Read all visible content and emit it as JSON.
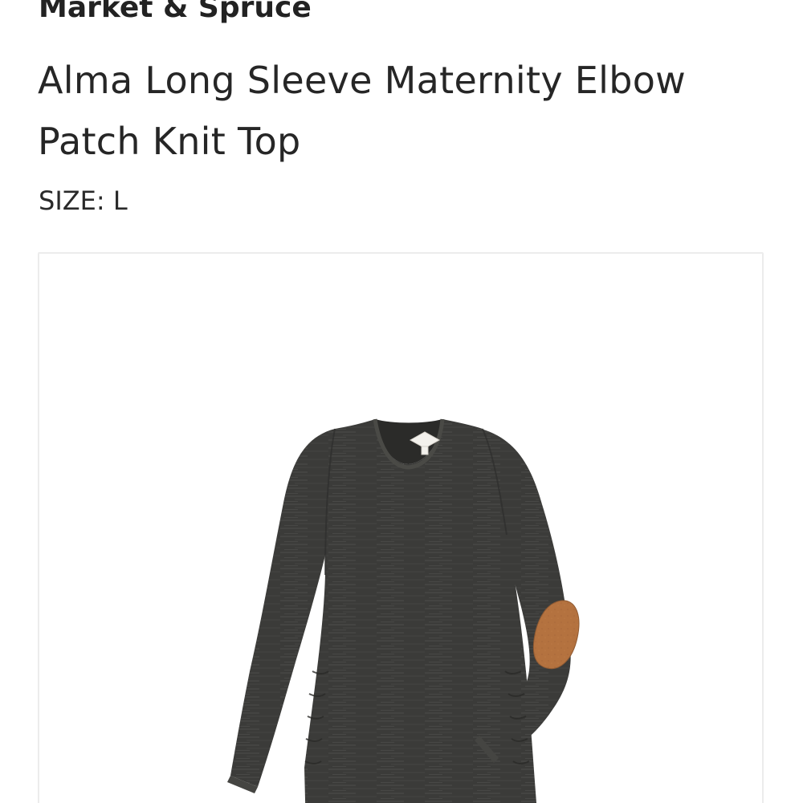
{
  "product": {
    "brand": "Market & Spruce",
    "name": "Alma Long Sleeve Maternity Elbow Patch Knit Top",
    "size_label": "SIZE:",
    "size_value": "L",
    "image": {
      "alt": "Charcoal heathered long sleeve maternity knit top with brown elbow patch",
      "garment_color": "#3b3b39",
      "patch_color": "#b4723f"
    }
  }
}
